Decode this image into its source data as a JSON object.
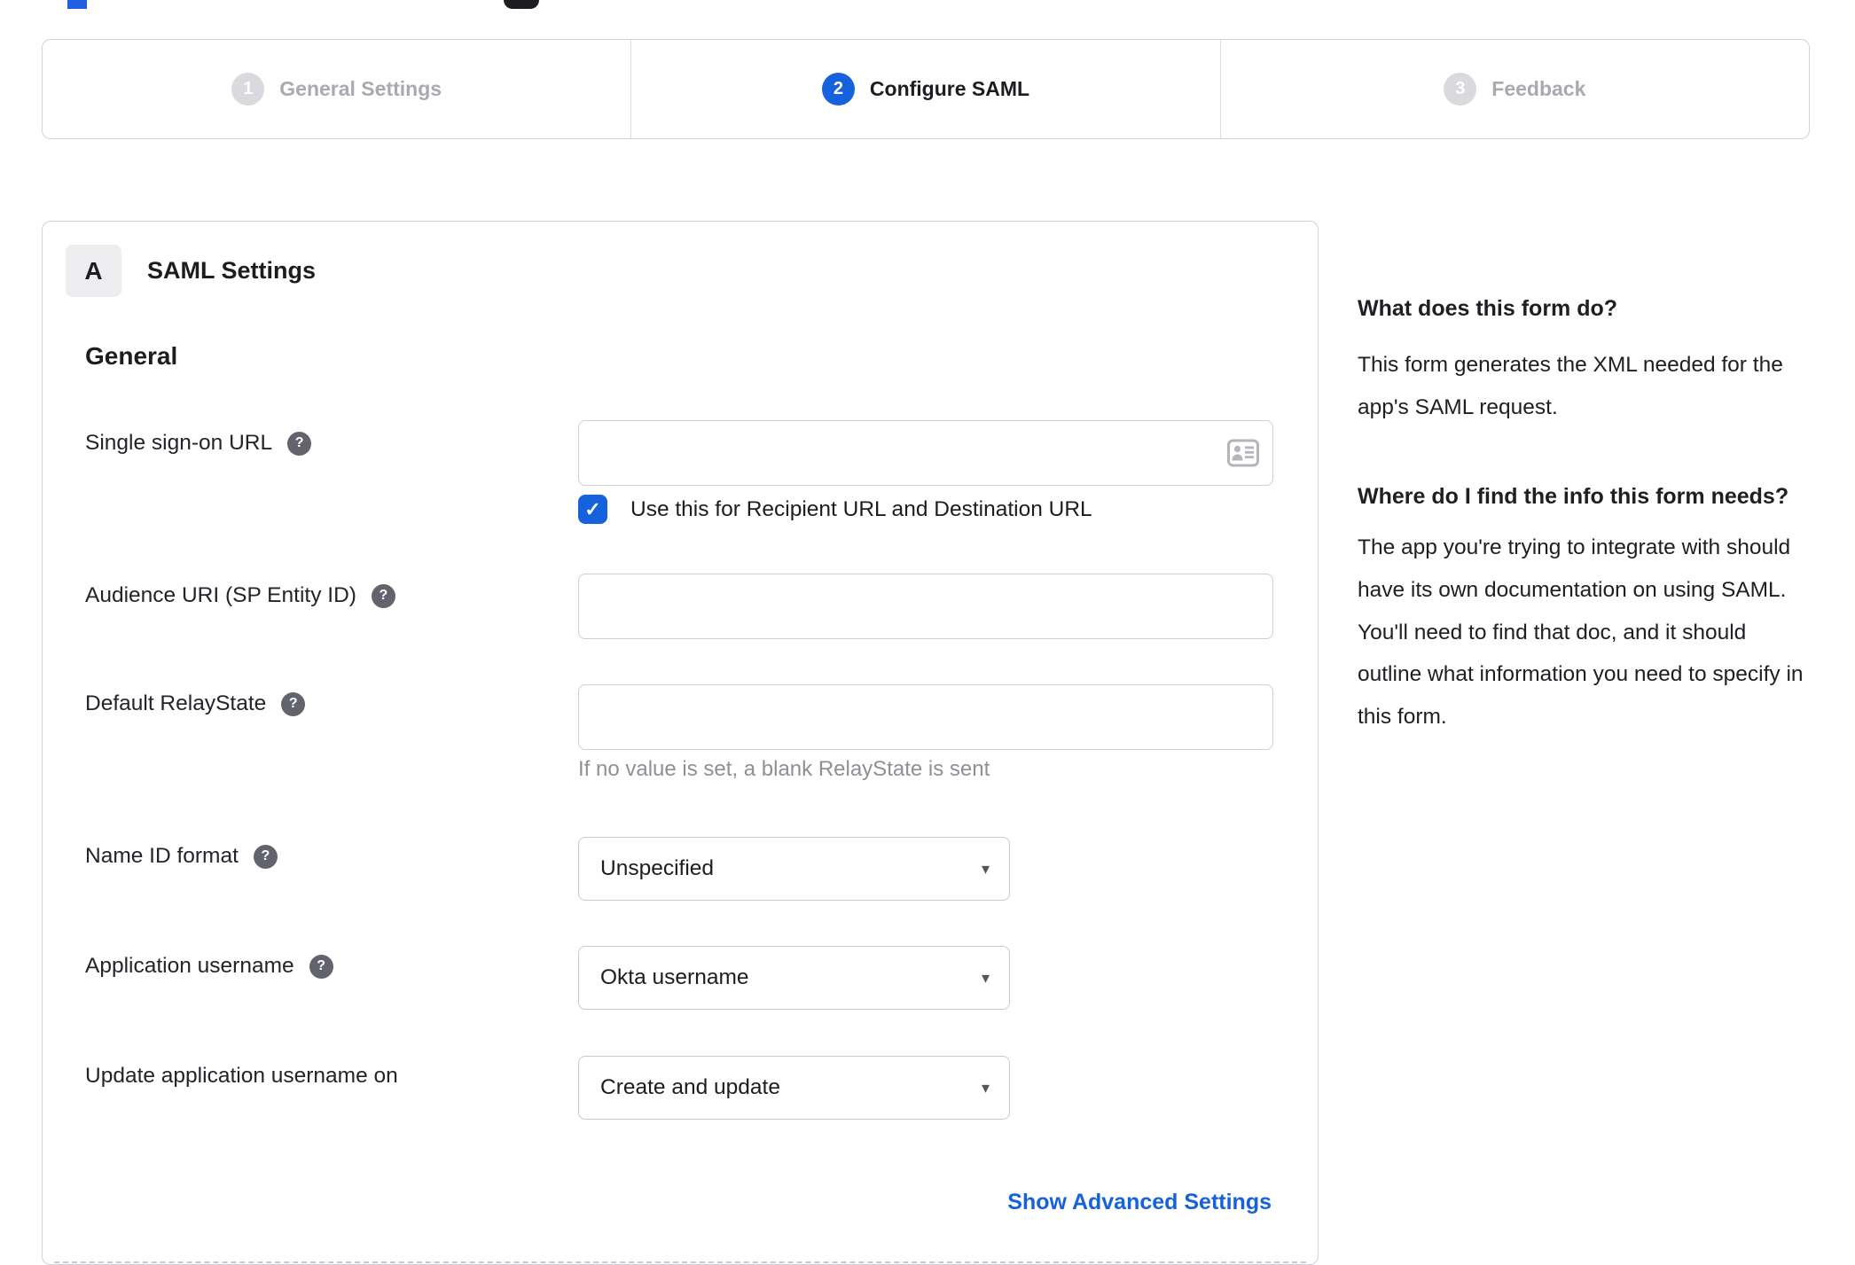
{
  "colors": {
    "accent_blue": "#1662dd",
    "link_blue": "#1662dd",
    "inactive_gray": "#a9a9b0",
    "helper_gray": "#8f8f96"
  },
  "glyphs": {
    "help": "?",
    "check": "✓",
    "caret": "▾"
  },
  "stepper": {
    "steps": [
      {
        "number": "1",
        "label": "General Settings",
        "state": "inactive"
      },
      {
        "number": "2",
        "label": "Configure SAML",
        "state": "active"
      },
      {
        "number": "3",
        "label": "Feedback",
        "state": "inactive"
      }
    ]
  },
  "panel": {
    "badge": "A",
    "title": "SAML Settings",
    "group": "General",
    "fields": {
      "sso": {
        "label": "Single sign-on URL",
        "value": "",
        "checkbox_checked": true,
        "checkbox_label": "Use this for Recipient URL and Destination URL"
      },
      "audience": {
        "label": "Audience URI (SP Entity ID)",
        "value": ""
      },
      "relaystate": {
        "label": "Default RelayState",
        "value": "",
        "helper": "If no value is set, a blank RelayState is sent"
      },
      "name_id_format": {
        "label": "Name ID format",
        "value": "Unspecified"
      },
      "application_username": {
        "label": "Application username",
        "value": "Okta username"
      },
      "update_application_username_on": {
        "label": "Update application username on",
        "value": "Create and update"
      }
    },
    "advanced_link": "Show Advanced Settings"
  },
  "sidebar": {
    "section1": {
      "title": "What does this form do?",
      "body": "This form generates the XML needed for the app's SAML request."
    },
    "section2": {
      "title": "Where do I find the info this form needs?",
      "body": "The app you're trying to integrate with should have its own documentation on using SAML. You'll need to find that doc, and it should outline what information you need to specify in this form."
    }
  }
}
